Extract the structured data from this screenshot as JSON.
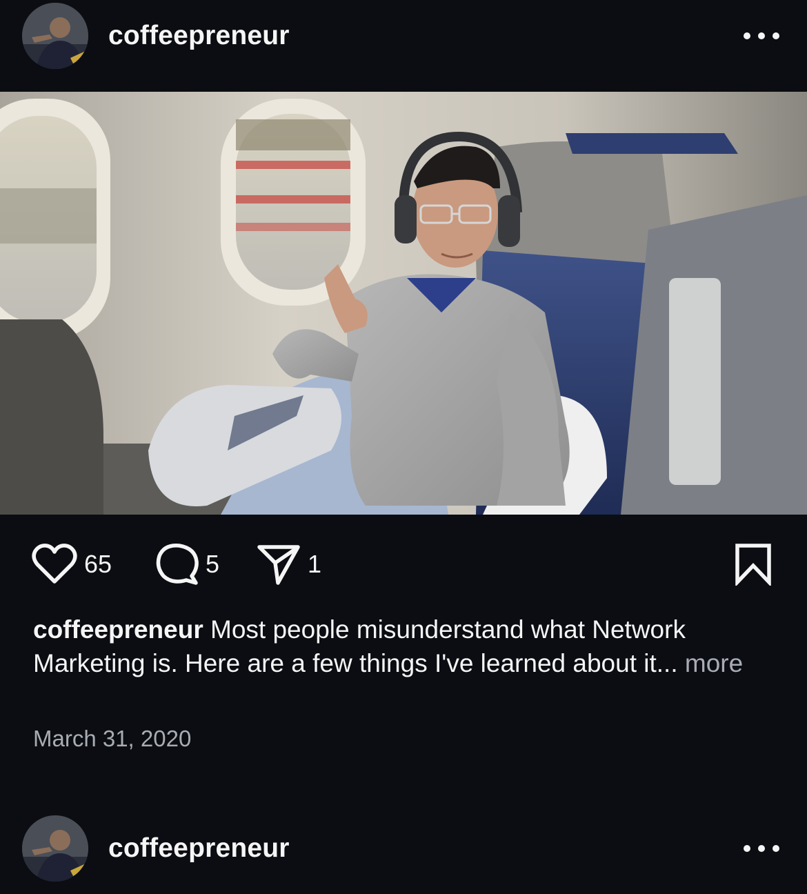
{
  "post": {
    "username": "coffeepreneur",
    "likes": "65",
    "comments": "5",
    "shares": "1",
    "caption_user": "coffeepreneur",
    "caption_text": "Most people misunderstand what Network Marketing is. Here are a few things I've learned about it...",
    "caption_more": "more",
    "date": "March 31, 2020"
  },
  "next_post": {
    "username": "coffeepreneur"
  },
  "icons": {
    "avatar": "profile-photo",
    "more": "more-options-icon",
    "like": "heart-icon",
    "comment": "comment-bubble-icon",
    "share": "paper-plane-icon",
    "save": "bookmark-icon"
  },
  "colors": {
    "background": "#0b0d12",
    "text": "#f5f5f5",
    "secondary_text": "#a8acb3"
  }
}
